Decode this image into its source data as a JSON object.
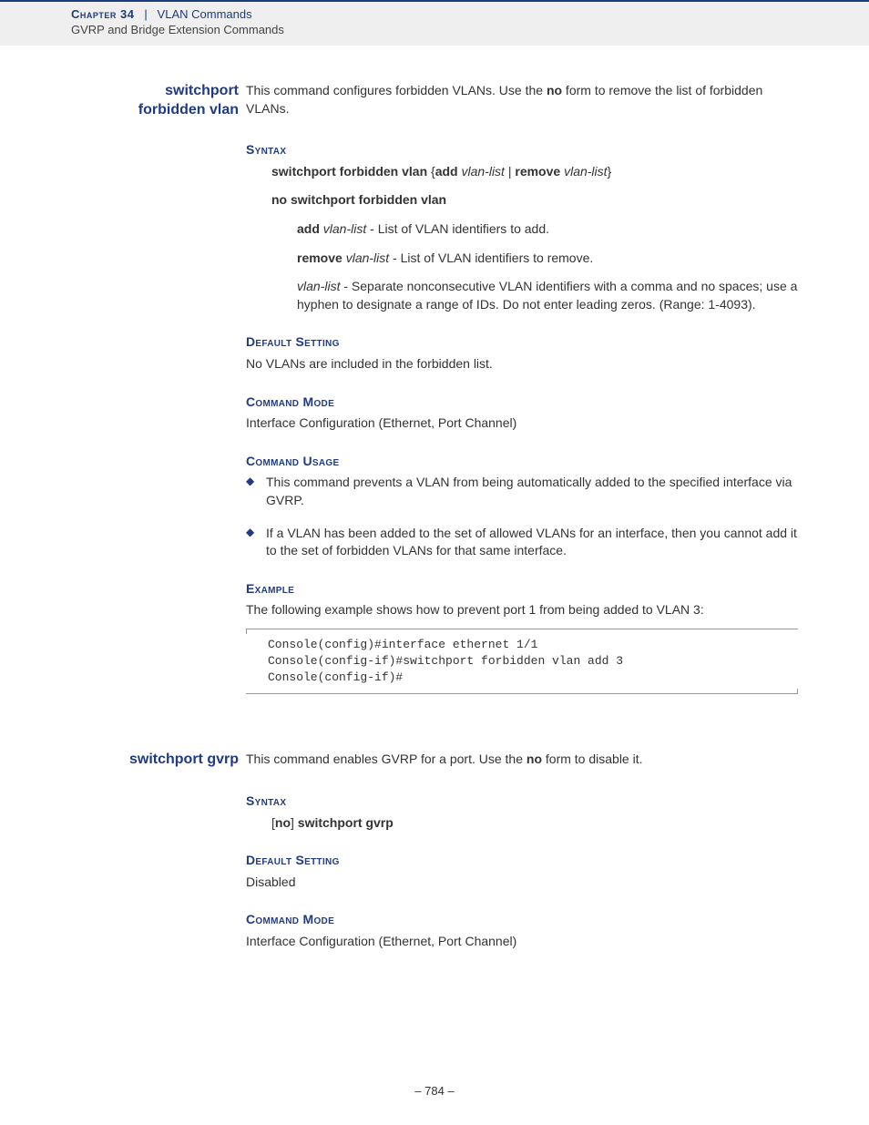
{
  "header": {
    "chapter_label": "Chapter 34",
    "pipe": "|",
    "chapter_title": "VLAN Commands",
    "subtitle": "GVRP and Bridge Extension Commands"
  },
  "cmd1": {
    "label_line1": "switchport",
    "label_line2": "forbidden vlan",
    "desc_pre": "This command configures forbidden VLANs. Use the ",
    "desc_bold": "no",
    "desc_post": " form to remove the list of forbidden VLANs.",
    "syntax_head": "Syntax",
    "syntax_main_b1": "switchport forbidden vlan",
    "syntax_main_brace_open": " {",
    "syntax_main_b2": "add",
    "syntax_main_it1": " vlan-list",
    "syntax_main_pipe": " | ",
    "syntax_main_b3": "remove",
    "syntax_main_it2": " vlan-list",
    "syntax_main_brace_close": "}",
    "syntax_no": "no switchport forbidden vlan",
    "param_add_b": "add",
    "param_add_it": " vlan-list",
    "param_add_rest": " - List of VLAN identifiers to add.",
    "param_rem_b": "remove",
    "param_rem_it": " vlan-list",
    "param_rem_rest": " - List of VLAN identifiers to remove.",
    "param_vl_it": "vlan-list",
    "param_vl_rest": " - Separate nonconsecutive VLAN identifiers with a comma and no spaces; use a hyphen to designate a range of IDs. Do not enter leading zeros. (Range: 1-4093).",
    "default_head": "Default Setting",
    "default_text": "No VLANs are included in the forbidden list.",
    "mode_head": "Command Mode",
    "mode_text": "Interface Configuration (Ethernet, Port Channel)",
    "usage_head": "Command Usage",
    "usage_items": [
      "This command prevents a VLAN from being automatically added to the specified interface via GVRP.",
      "If a VLAN has been added to the set of allowed VLANs for an interface, then you cannot add it to the set of forbidden VLANs for that same interface."
    ],
    "example_head": "Example",
    "example_text": "The following example shows how to prevent port 1 from being added to VLAN 3:",
    "example_code": "Console(config)#interface ethernet 1/1\nConsole(config-if)#switchport forbidden vlan add 3\nConsole(config-if)#"
  },
  "cmd2": {
    "label": "switchport gvrp",
    "desc_pre": "This command enables GVRP for a port. Use the ",
    "desc_bold": "no",
    "desc_post": " form to disable it.",
    "syntax_head": "Syntax",
    "syntax_open": "[",
    "syntax_no": "no",
    "syntax_close": "] ",
    "syntax_cmd": "switchport gvrp",
    "default_head": "Default Setting",
    "default_text": "Disabled",
    "mode_head": "Command Mode",
    "mode_text": "Interface Configuration (Ethernet, Port Channel)"
  },
  "footer": {
    "page": "–  784  –"
  }
}
